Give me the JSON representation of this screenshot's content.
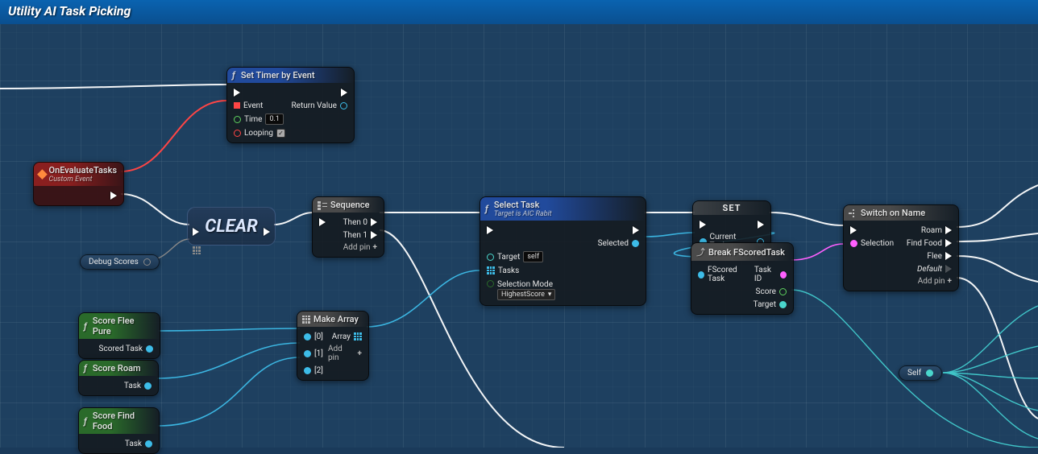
{
  "title": "Utility AI Task Picking",
  "nodes": {
    "setTimer": {
      "title": "Set Timer by Event",
      "pins": {
        "event": "Event",
        "time": "Time",
        "timeVal": "0.1",
        "looping": "Looping",
        "retval": "Return Value"
      }
    },
    "onEval": {
      "title": "OnEvaluateTasks",
      "sub": "Custom Event"
    },
    "debugScores": {
      "label": "Debug Scores"
    },
    "clear": {
      "label": "CLEAR"
    },
    "sequence": {
      "title": "Sequence",
      "then0": "Then 0",
      "then1": "Then 1",
      "addpin": "Add pin"
    },
    "scoreFlee": {
      "title": "Score Flee Pure",
      "out": "Scored Task"
    },
    "scoreRoam": {
      "title": "Score Roam",
      "out": "Task"
    },
    "scoreFind": {
      "title": "Score Find Food",
      "out": "Task"
    },
    "makeArray": {
      "title": "Make Array",
      "p0": "[0]",
      "p1": "[1]",
      "p2": "[2]",
      "out": "Array",
      "addpin": "Add pin"
    },
    "selectTask": {
      "title": "Select Task",
      "sub": "Target is AIC Rabit",
      "target": "Target",
      "targetVal": "self",
      "tasks": "Tasks",
      "selmode": "Selection Mode",
      "selval": "HighestScore",
      "selected": "Selected"
    },
    "set": {
      "title": "SET",
      "in": "Current Task"
    },
    "breakF": {
      "title": "Break FScoredTask",
      "in": "FScored Task",
      "tid": "Task ID",
      "score": "Score",
      "target": "Target"
    },
    "switch": {
      "title": "Switch on Name",
      "sel": "Selection",
      "roam": "Roam",
      "find": "Find Food",
      "flee": "Flee",
      "def": "Default",
      "addpin": "Add pin"
    },
    "self": {
      "label": "Self"
    }
  }
}
